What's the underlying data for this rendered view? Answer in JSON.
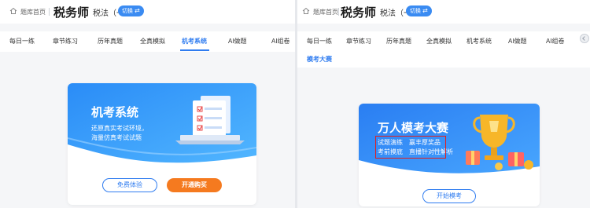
{
  "left": {
    "header": {
      "home_label": "题库首页",
      "title": "税务师",
      "subject": "税法（一）",
      "switch_label": "切换"
    },
    "tabs": [
      {
        "label": "每日一练",
        "active": false
      },
      {
        "label": "章节练习",
        "active": false
      },
      {
        "label": "历年真题",
        "active": false
      },
      {
        "label": "全真模拟",
        "active": false
      },
      {
        "label": "机考系统",
        "active": true
      },
      {
        "label": "AI做题",
        "active": false
      },
      {
        "label": "AI组卷",
        "active": false
      }
    ],
    "card": {
      "title": "机考系统",
      "desc_line1": "还原真实考试环境，",
      "desc_line2": "海量仿真考试试题",
      "trial_button": "免费体验",
      "buy_button": "开通购买"
    }
  },
  "right": {
    "header": {
      "home_label": "题库首页",
      "title": "税务师",
      "subject": "税法（一）",
      "switch_label": "切换"
    },
    "tabs": [
      {
        "label": "每日一练",
        "active": false
      },
      {
        "label": "章节练习",
        "active": false
      },
      {
        "label": "历年真题",
        "active": false
      },
      {
        "label": "全真模拟",
        "active": false
      },
      {
        "label": "机考系统",
        "active": false
      },
      {
        "label": "AI做题",
        "active": false
      },
      {
        "label": "AI组卷",
        "active": false
      }
    ],
    "subtab": "模考大赛",
    "card": {
      "title": "万人模考大赛",
      "feature_1": "试题演练",
      "feature_2": "赢丰厚奖品",
      "feature_3": "考前摸底",
      "feature_4": "直播针对性解析",
      "start_button": "开始模考"
    }
  },
  "colors": {
    "brand_blue": "#2f7cf0",
    "orange": "#f57a1f",
    "highlight_red": "#e02020"
  },
  "icons": [
    "home-icon",
    "switch-icon",
    "chevron-right-icon",
    "document-laptop-illustration",
    "trophy-illustration"
  ]
}
